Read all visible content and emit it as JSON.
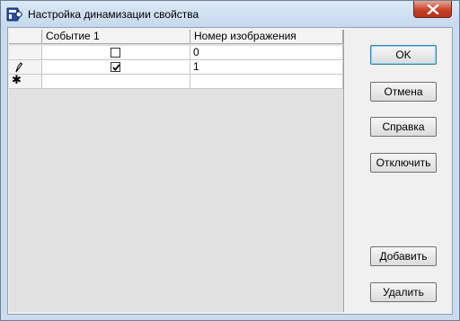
{
  "window": {
    "title": "Настройка динамизации свойства"
  },
  "grid": {
    "columns": [
      "",
      "Событие 1",
      "Номер изображения"
    ],
    "rows": [
      {
        "indicator": "",
        "event_checked": false,
        "image_number": "0"
      },
      {
        "indicator": "pencil-icon",
        "event_checked": true,
        "image_number": "1"
      },
      {
        "indicator": "new-row-asterisk",
        "event_checked": null,
        "image_number": ""
      }
    ],
    "new_row_marker": "✱"
  },
  "buttons": {
    "ok": "OK",
    "cancel": "Отмена",
    "help": "Справка",
    "disable": "Отключить",
    "add": "Добавить",
    "delete": "Удалить"
  },
  "colors": {
    "title_bar": "#c9dcef",
    "close_button": "#c7432c",
    "grid_background": "#e1e1e1",
    "default_button_border": "#3c7fb1"
  }
}
